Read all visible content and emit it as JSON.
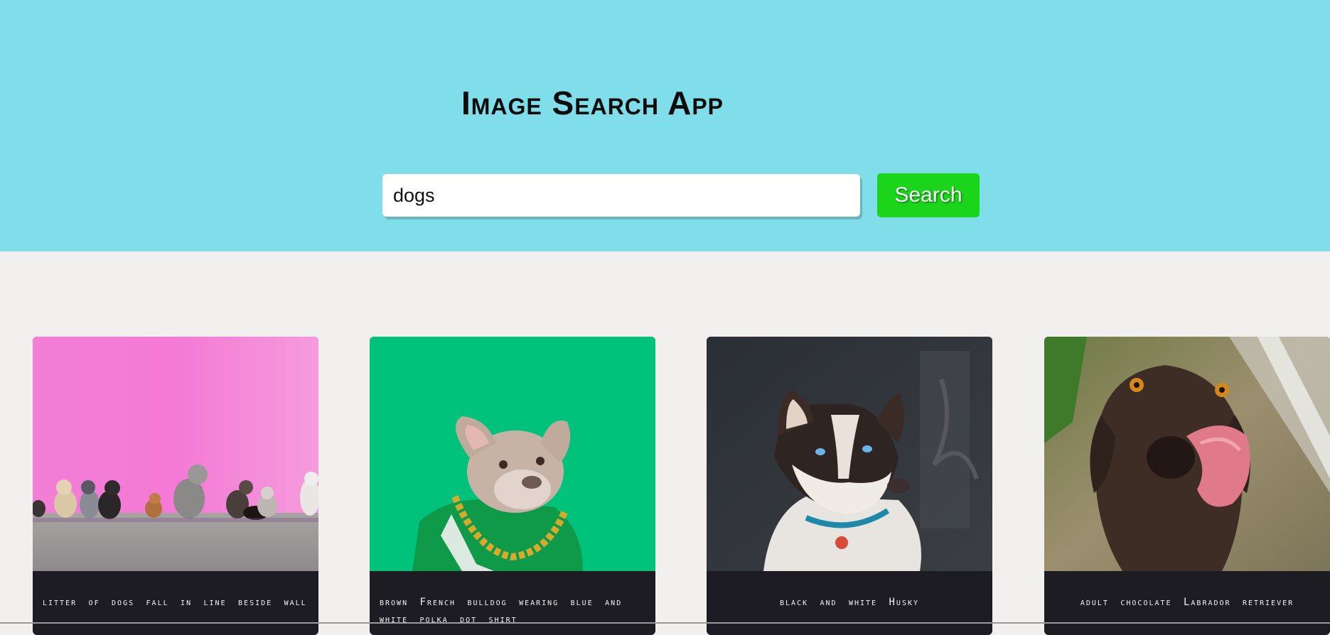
{
  "header": {
    "title": "Image Search App",
    "background": "#80deea"
  },
  "search": {
    "value": "dogs",
    "button_label": "Search",
    "button_color": "#1bd51b"
  },
  "results": [
    {
      "caption": "litter of dogs fall in line beside wall",
      "image": "dogs-on-pink-wall-photo"
    },
    {
      "caption": "brown French bulldog wearing blue and white polka dot shirt",
      "image": "french-bulldog-green-background-photo"
    },
    {
      "caption": "black and white Husky",
      "image": "husky-photo"
    },
    {
      "caption": "adult chocolate Labrador retriever",
      "image": "chocolate-labrador-photo"
    }
  ]
}
